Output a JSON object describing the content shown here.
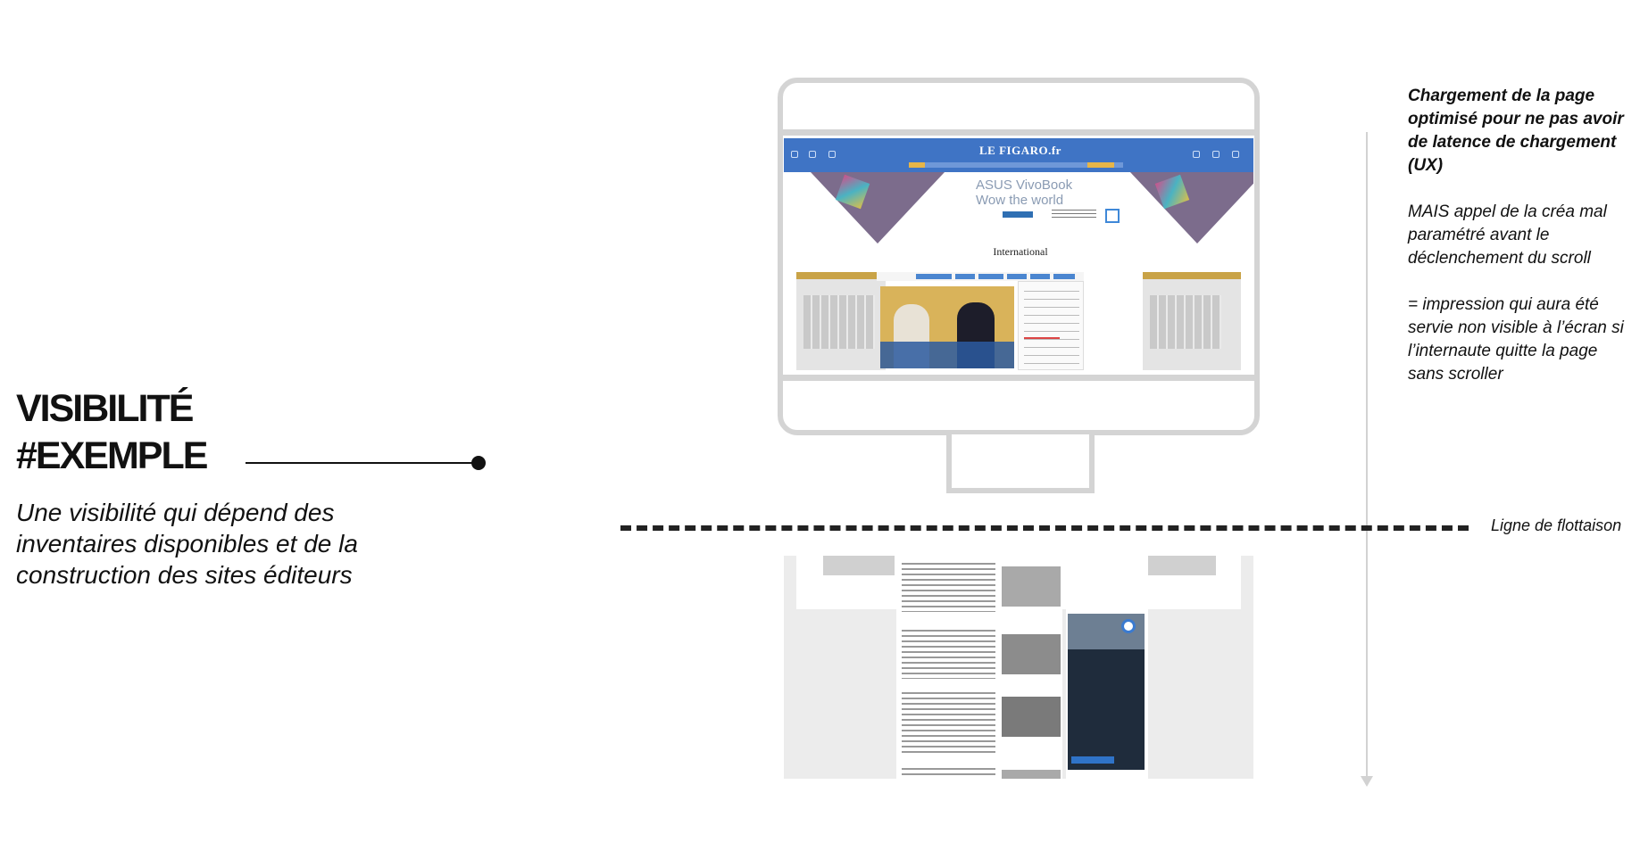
{
  "left": {
    "title_line1": "VISIBILITÉ",
    "title_line2": "#EXEMPLE",
    "subtitle": "Une visibilité qui dépend des inventaires disponibles et de la construction des sites éditeurs"
  },
  "note": {
    "paragraph1": "Chargement de la page optimisé pour ne pas avoir de latence de chargement (UX)",
    "paragraph2": "MAIS appel de la créa mal paramétré avant le déclenchement du scroll",
    "paragraph3": "= impression qui aura été servie non visible à l’écran si l’internaute quitte la page sans scroller"
  },
  "fold_label": "Ligne de flottaison",
  "screenshot": {
    "site_logo": "LE FIGARO.fr",
    "ad_text": "ASUS VivoBook Wow the world",
    "section_title": "International"
  },
  "colors": {
    "site_header": "#3f74c5",
    "monitor_frame": "#d4d4d4",
    "fold_line": "#222222",
    "arrow": "#d2d2d2"
  }
}
